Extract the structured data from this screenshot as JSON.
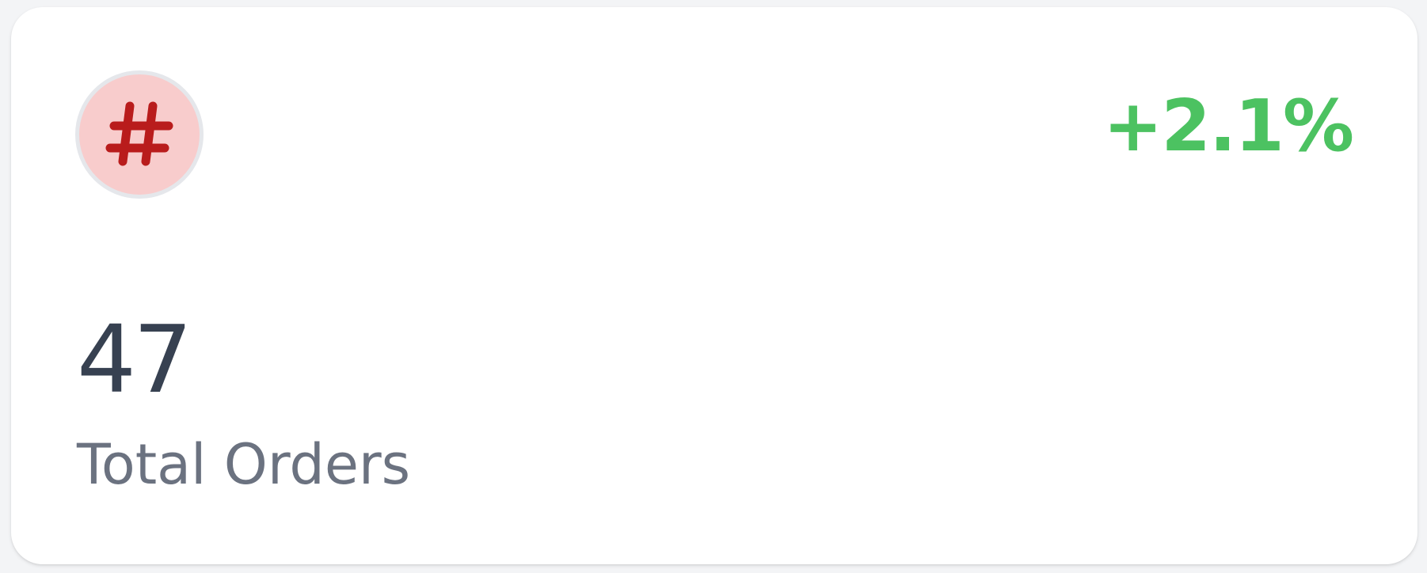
{
  "stat_card": {
    "icon": "hash-icon",
    "change": "+2.1%",
    "value": "47",
    "label": "Total Orders"
  },
  "colors": {
    "icon_bg": "#f8cccc",
    "icon_fg": "#b91c1c",
    "change_positive": "#4cc261",
    "value_text": "#374151",
    "label_text": "#6b7280"
  }
}
